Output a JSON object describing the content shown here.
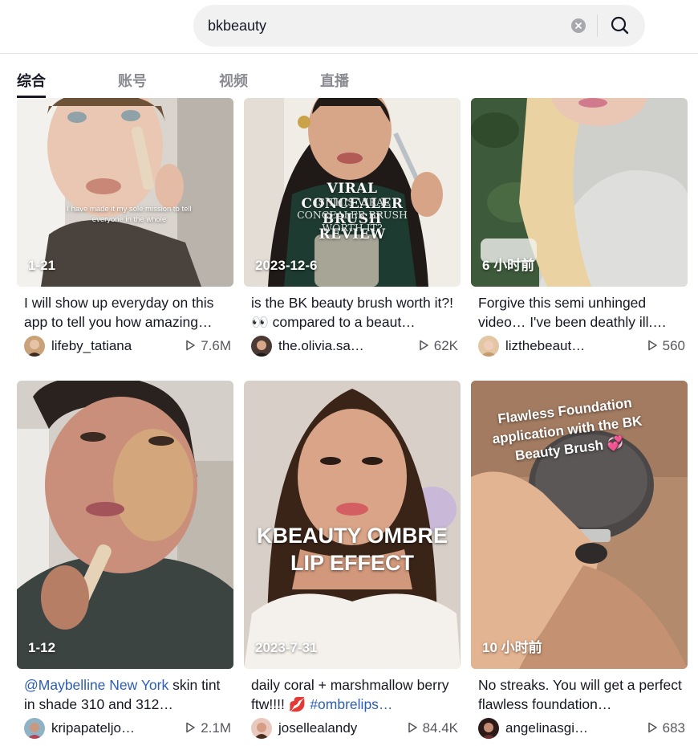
{
  "search": {
    "query": "bkbeauty"
  },
  "tabs": [
    {
      "label": "综合",
      "active": true
    },
    {
      "label": "账号"
    },
    {
      "label": "视频"
    },
    {
      "label": "直播"
    }
  ],
  "videos": [
    {
      "badge": "1-21",
      "overlay_text": "I have made it my sole mission to tell everyone in the whole",
      "caption": "I will show up everyday on this app to tell you how amazing…",
      "author": "lifeby_tatiana",
      "views": "7.6M"
    },
    {
      "badge": "2023-12-6",
      "overlay_text": "VIRAL CONCEALER BRUSH REVIEW",
      "overlay_text_2": "IS THIS VIRAL CONCEALER BRUSH WORTH IT?",
      "caption": "is the BK beauty brush worth it?! 👀 compared to a beaut…",
      "author": "the.olivia.sa…",
      "views": "62K"
    },
    {
      "badge": "6 小时前",
      "caption": "Forgive this semi unhinged video… I've been deathly ill.…",
      "author": "lizthebeaut…",
      "views": "560"
    },
    {
      "badge": "1-12",
      "caption_mention": "@Maybelline New York",
      "caption": " skin tint in shade 310 and 312…",
      "author": "kripapateljo…",
      "views": "2.1M"
    },
    {
      "badge": "2023-7-31",
      "overlay_text": "KBEAUTY OMBRE LIP EFFECT",
      "caption": "daily coral + marshmallow berry ftw!!!! 💋 ",
      "caption_mention": "#ombrelips…",
      "author": "josellealandy",
      "views": "84.4K"
    },
    {
      "badge": "10 小时前",
      "overlay_text": "Flawless Foundation application with the BK Beauty Brush 💞",
      "caption": "No streaks. You will get a perfect flawless foundation…",
      "author": "angelinasgi…",
      "views": "683"
    }
  ],
  "colors": {
    "mention": "#2b5db9",
    "active_tab": "#161823",
    "inactive_tab": "#8a8b91"
  }
}
